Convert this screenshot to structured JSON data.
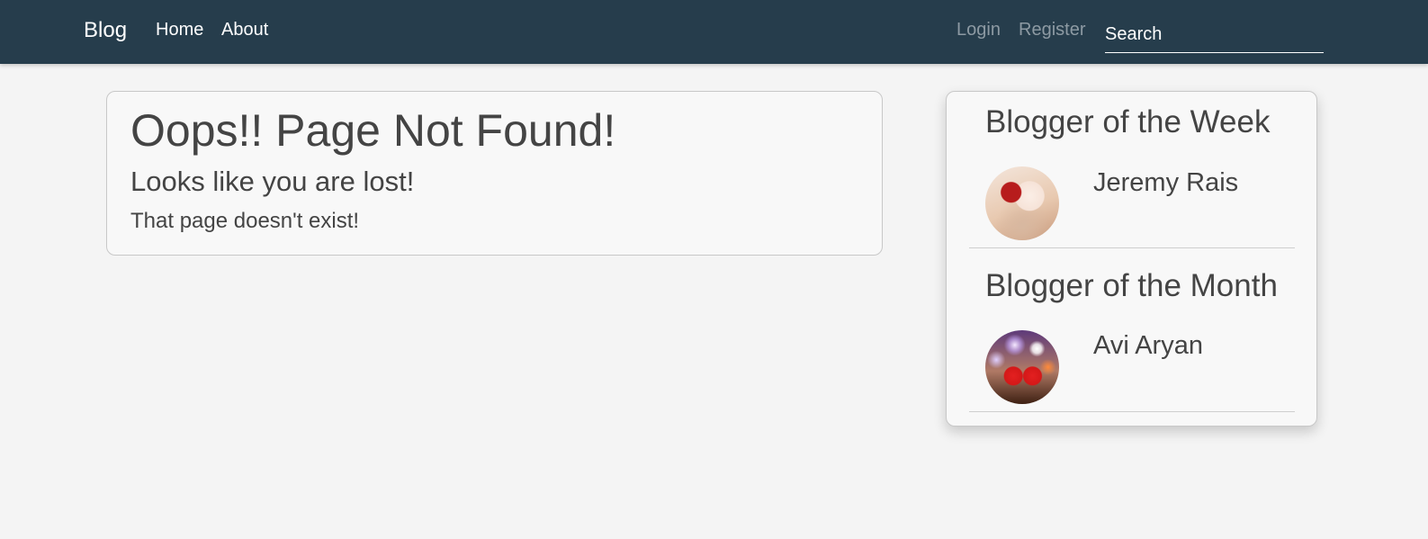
{
  "navbar": {
    "brand": "Blog",
    "links": {
      "home": "Home",
      "about": "About"
    },
    "auth": {
      "login": "Login",
      "register": "Register"
    },
    "search": {
      "placeholder": "Search",
      "value": ""
    }
  },
  "error": {
    "title": "Oops!! Page Not Found!",
    "subtitle": "Looks like you are lost!",
    "message": "That page doesn't exist!"
  },
  "sidebar": {
    "week": {
      "title": "Blogger of the Week",
      "name": "Jeremy Rais"
    },
    "month": {
      "title": "Blogger of the Month",
      "name": "Avi Aryan"
    }
  },
  "colors": {
    "navbar_bg": "#263d4c",
    "page_bg": "#f4f4f4",
    "text": "#444444",
    "muted_link": "#8d9aa3"
  }
}
